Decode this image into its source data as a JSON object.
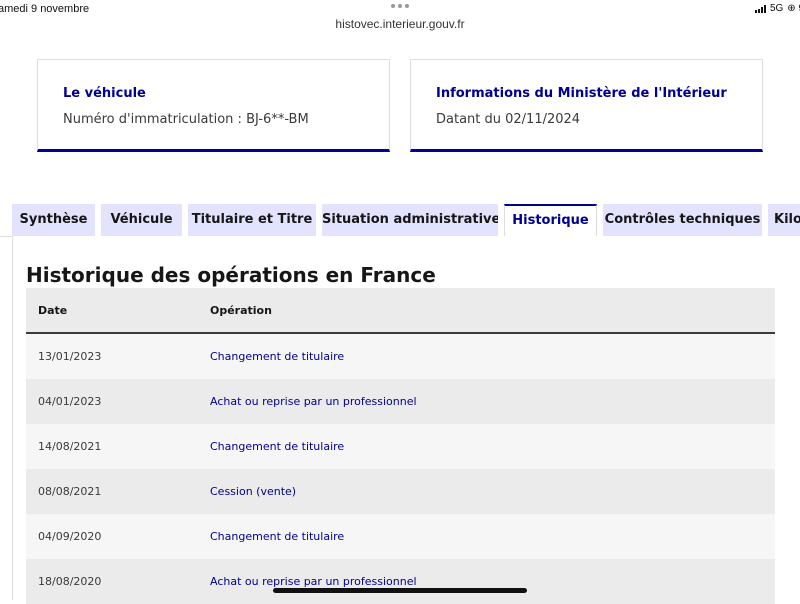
{
  "status_bar": {
    "date": "amedi 9 novembre",
    "url": "histovec.interieur.gouv.fr",
    "network": "5G",
    "right_trail": "⊕ 9"
  },
  "cards": [
    {
      "title": "Le véhicule",
      "text": "Numéro d'immatriculation : BJ-6**-BM"
    },
    {
      "title": "Informations du Ministère de l'Intérieur",
      "text": "Datant du 02/11/2024"
    }
  ],
  "tabs": [
    {
      "label": "Synthèse",
      "active": false
    },
    {
      "label": "Véhicule",
      "active": false
    },
    {
      "label": "Titulaire et Titre",
      "active": false
    },
    {
      "label": "Situation administrative",
      "active": false
    },
    {
      "label": "Historique",
      "active": true
    },
    {
      "label": "Contrôles techniques",
      "active": false
    },
    {
      "label": "Kilo",
      "active": false
    }
  ],
  "section": {
    "title": "Historique des opérations en France"
  },
  "table": {
    "headers": [
      "Date",
      "Opération"
    ],
    "rows": [
      {
        "date": "13/01/2023",
        "operation": "Changement de titulaire"
      },
      {
        "date": "04/01/2023",
        "operation": "Achat ou reprise par un professionnel"
      },
      {
        "date": "14/08/2021",
        "operation": "Changement de titulaire"
      },
      {
        "date": "08/08/2021",
        "operation": "Cession (vente)"
      },
      {
        "date": "04/09/2020",
        "operation": "Changement de titulaire"
      },
      {
        "date": "18/08/2020",
        "operation": "Achat ou reprise par un professionnel"
      }
    ]
  },
  "colors": {
    "accent": "#000091",
    "tab_background": "#e3e3fd",
    "row_light": "#f6f6f6",
    "row_dark": "#ebebeb"
  }
}
